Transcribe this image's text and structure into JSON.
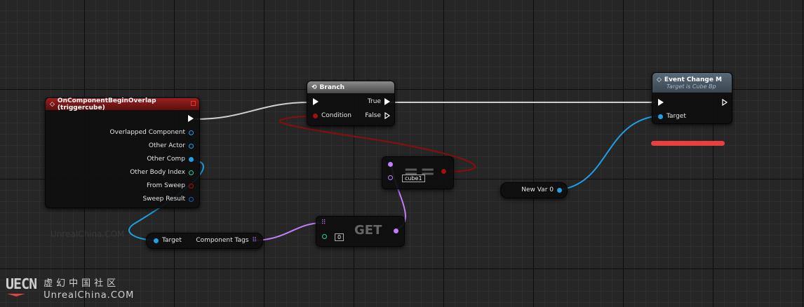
{
  "event_node": {
    "title": "OnComponentBeginOverlap (triggercube)",
    "color": "#8b1a1a",
    "pins": [
      "Overlapped Component",
      "Other Actor",
      "Other Comp",
      "Other Body Index",
      "From Sweep",
      "Sweep Result"
    ]
  },
  "branch_node": {
    "title": "Branch",
    "condition_label": "Condition",
    "true_label": "True",
    "false_label": "False"
  },
  "equal_node": {
    "symbol": "==",
    "value": "cube1"
  },
  "get_node": {
    "symbol": "GET",
    "index_value": "0"
  },
  "tags_node": {
    "target_label": "Target",
    "out_label": "Component Tags"
  },
  "change_node": {
    "title": "Event Change M",
    "subtitle": "Target is Cube Bp",
    "target_label": "Target",
    "color": "#4c5a66"
  },
  "var_node": {
    "label": "New Var 0"
  },
  "watermark": {
    "logo": "UECN",
    "chinese": "虚幻中国社区",
    "url": "UnrealChina.COM",
    "faint": "UnrealChina.COM"
  },
  "colors": {
    "object_pin": "#1e9fe6",
    "bool_pin": "#a01010",
    "int_pin": "#1ed1a0",
    "struct_pin": "#1a5fb4",
    "name_pin": "#c47cff",
    "exec": "#ffffff"
  }
}
